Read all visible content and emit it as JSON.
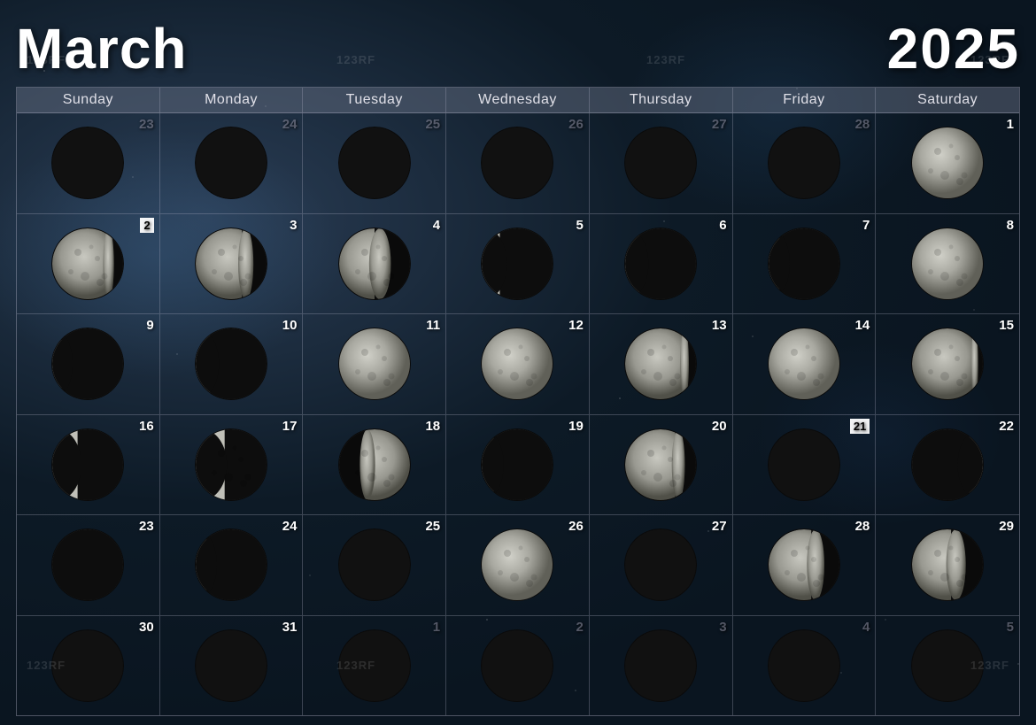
{
  "header": {
    "month": "March",
    "year": "2025"
  },
  "days_of_week": [
    "Sunday",
    "Monday",
    "Tuesday",
    "Wednesday",
    "Thursday",
    "Friday",
    "Saturday"
  ],
  "watermarks": [
    "123RF",
    "123RF",
    "123RF",
    "123RF",
    "123RF",
    "123RF",
    "123RF"
  ],
  "weeks": [
    [
      {
        "day": "23",
        "other": true,
        "phase": "new"
      },
      {
        "day": "24",
        "other": true,
        "phase": "new"
      },
      {
        "day": "25",
        "other": true,
        "phase": "new"
      },
      {
        "day": "26",
        "other": true,
        "phase": "new"
      },
      {
        "day": "27",
        "other": true,
        "phase": "new"
      },
      {
        "day": "28",
        "other": true,
        "phase": "new"
      },
      {
        "day": "1",
        "other": false,
        "phase": "full",
        "boxed": false
      }
    ],
    [
      {
        "day": "2",
        "other": false,
        "phase": "waning-gibbous",
        "boxed": true
      },
      {
        "day": "3",
        "other": false,
        "phase": "waning-gibbous2"
      },
      {
        "day": "4",
        "other": false,
        "phase": "third-quarter"
      },
      {
        "day": "5",
        "other": false,
        "phase": "waning-crescent"
      },
      {
        "day": "6",
        "other": false,
        "phase": "waning-crescent2"
      },
      {
        "day": "7",
        "other": false,
        "phase": "waning-crescent3"
      },
      {
        "day": "8",
        "other": false,
        "phase": "full-light"
      }
    ],
    [
      {
        "day": "9",
        "other": false,
        "phase": "waning-crescent4"
      },
      {
        "day": "10",
        "other": false,
        "phase": "waning-crescent5"
      },
      {
        "day": "11",
        "other": false,
        "phase": "full2"
      },
      {
        "day": "12",
        "other": false,
        "phase": "full3"
      },
      {
        "day": "13",
        "other": false,
        "phase": "waning-gibbous3"
      },
      {
        "day": "14",
        "other": false,
        "phase": "full4"
      },
      {
        "day": "15",
        "other": false,
        "phase": "waning-gibbous4"
      }
    ],
    [
      {
        "day": "16",
        "other": false,
        "phase": "waning-crescent6"
      },
      {
        "day": "17",
        "other": false,
        "phase": "waning-crescent7"
      },
      {
        "day": "18",
        "other": false,
        "phase": "waxing-gibbous"
      },
      {
        "day": "19",
        "other": false,
        "phase": "waning-crescent8"
      },
      {
        "day": "20",
        "other": false,
        "phase": "waning-gibbous5"
      },
      {
        "day": "21",
        "other": false,
        "phase": "new2",
        "boxed": true
      },
      {
        "day": "22",
        "other": false,
        "phase": "waxing-crescent"
      }
    ],
    [
      {
        "day": "23",
        "other": false,
        "phase": "waning-crescent9"
      },
      {
        "day": "24",
        "other": false,
        "phase": "waning-crescent10"
      },
      {
        "day": "25",
        "other": false,
        "phase": "new3"
      },
      {
        "day": "26",
        "other": false,
        "phase": "full5"
      },
      {
        "day": "27",
        "other": false,
        "phase": "new4"
      },
      {
        "day": "28",
        "other": false,
        "phase": "waning-gibbous6"
      },
      {
        "day": "29",
        "other": false,
        "phase": "waning-gibbous7"
      }
    ],
    [
      {
        "day": "30",
        "other": false,
        "phase": "new5"
      },
      {
        "day": "31",
        "other": false,
        "phase": "new6"
      },
      {
        "day": "1",
        "other": true,
        "phase": "new"
      },
      {
        "day": "2",
        "other": true,
        "phase": "new"
      },
      {
        "day": "3",
        "other": true,
        "phase": "new"
      },
      {
        "day": "4",
        "other": true,
        "phase": "new"
      },
      {
        "day": "5",
        "other": true,
        "phase": "new"
      }
    ]
  ]
}
